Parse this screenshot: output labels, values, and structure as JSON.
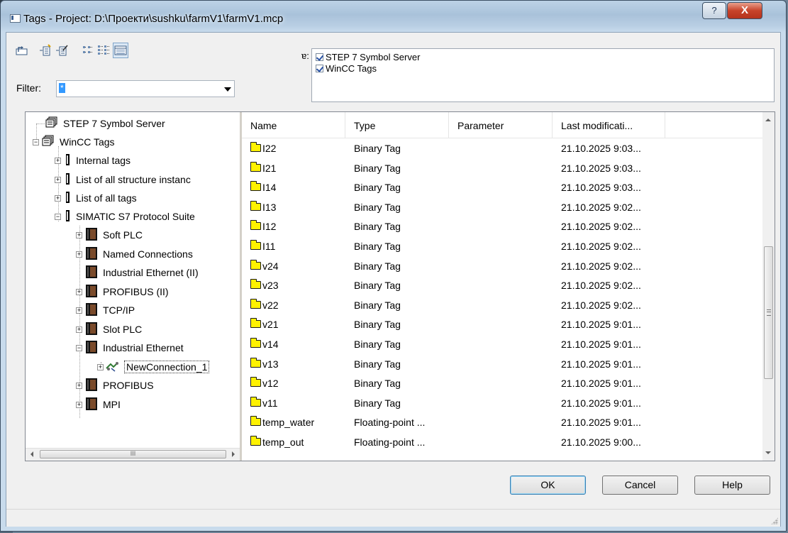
{
  "window": {
    "title": "Tags - Project: D:\\Проекти\\sushku\\farmV1\\farmV1.mcp"
  },
  "titlebar_buttons": {
    "help": "?",
    "close": "X"
  },
  "toolbar": {
    "icons": [
      "up-level-icon",
      "new-tag-icon",
      "edit-tag-icon",
      "small-icons-view-icon",
      "list-view-icon",
      "details-view-icon"
    ]
  },
  "filter": {
    "label": "Filter:",
    "value": "*"
  },
  "sources": {
    "cut_label": "ɐ:",
    "items": [
      {
        "label": "STEP 7 Symbol Server",
        "checked": true
      },
      {
        "label": "WinCC Tags",
        "checked": true
      }
    ]
  },
  "tree": {
    "nodes": [
      {
        "label": "STEP 7 Symbol Server"
      },
      {
        "label": "WinCC Tags"
      },
      {
        "label": "Internal tags"
      },
      {
        "label": "List of all structure instanc"
      },
      {
        "label": "List of all tags"
      },
      {
        "label": "SIMATIC S7 Protocol Suite"
      },
      {
        "label": "Soft PLC"
      },
      {
        "label": "Named Connections"
      },
      {
        "label": "Industrial Ethernet (II)"
      },
      {
        "label": "PROFIBUS (II)"
      },
      {
        "label": "TCP/IP"
      },
      {
        "label": "Slot PLC"
      },
      {
        "label": "Industrial Ethernet"
      },
      {
        "label": "NewConnection_1"
      },
      {
        "label": "PROFIBUS"
      },
      {
        "label": "MPI"
      }
    ],
    "hscroll_grip": "III"
  },
  "list": {
    "columns": [
      "Name",
      "Type",
      "Parameter",
      "Last modificati..."
    ],
    "rows": [
      {
        "name": "I22",
        "type": "Binary Tag",
        "parameter": "",
        "modified": "21.10.2025 9:03..."
      },
      {
        "name": "I21",
        "type": "Binary Tag",
        "parameter": "",
        "modified": "21.10.2025 9:03..."
      },
      {
        "name": "I14",
        "type": "Binary Tag",
        "parameter": "",
        "modified": "21.10.2025 9:03..."
      },
      {
        "name": "I13",
        "type": "Binary Tag",
        "parameter": "",
        "modified": "21.10.2025 9:02..."
      },
      {
        "name": "I12",
        "type": "Binary Tag",
        "parameter": "",
        "modified": "21.10.2025 9:02..."
      },
      {
        "name": "I11",
        "type": "Binary Tag",
        "parameter": "",
        "modified": "21.10.2025 9:02..."
      },
      {
        "name": "v24",
        "type": "Binary Tag",
        "parameter": "",
        "modified": "21.10.2025 9:02..."
      },
      {
        "name": "v23",
        "type": "Binary Tag",
        "parameter": "",
        "modified": "21.10.2025 9:02..."
      },
      {
        "name": "v22",
        "type": "Binary Tag",
        "parameter": "",
        "modified": "21.10.2025 9:02..."
      },
      {
        "name": "v21",
        "type": "Binary Tag",
        "parameter": "",
        "modified": "21.10.2025 9:01..."
      },
      {
        "name": "v14",
        "type": "Binary Tag",
        "parameter": "",
        "modified": "21.10.2025 9:01..."
      },
      {
        "name": "v13",
        "type": "Binary Tag",
        "parameter": "",
        "modified": "21.10.2025 9:01..."
      },
      {
        "name": "v12",
        "type": "Binary Tag",
        "parameter": "",
        "modified": "21.10.2025 9:01..."
      },
      {
        "name": "v11",
        "type": "Binary Tag",
        "parameter": "",
        "modified": "21.10.2025 9:01..."
      },
      {
        "name": "temp_water",
        "type": "Floating-point ...",
        "parameter": "",
        "modified": "21.10.2025 9:01..."
      },
      {
        "name": "temp_out",
        "type": "Floating-point ...",
        "parameter": "",
        "modified": "21.10.2025 9:00..."
      }
    ]
  },
  "buttons": {
    "ok": "OK",
    "cancel": "Cancel",
    "help": "Help"
  },
  "colors": {
    "tag_icon": "#fff200",
    "selection": "#3399ff",
    "close_button": "#c7432a"
  }
}
